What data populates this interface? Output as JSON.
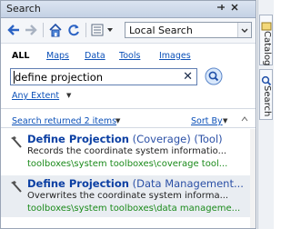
{
  "window": {
    "title": "Search"
  },
  "toolbar": {
    "scope_value": "Local Search"
  },
  "filter_tabs": [
    "ALL",
    "Maps",
    "Data",
    "Tools",
    "Images"
  ],
  "search": {
    "query": "define projection"
  },
  "extent": {
    "label": "Any Extent"
  },
  "results_bar": {
    "summary": "Search returned 2 items",
    "sort_label": "Sort By"
  },
  "results": [
    {
      "name": "Define Projection",
      "type": "(Coverage) (Tool)",
      "description": "Records the coordinate system informatio...",
      "path": "toolboxes\\system toolboxes\\coverage tool..."
    },
    {
      "name": "Define Projection",
      "type": "(Data Management...",
      "description": "Overwrites the coordinate system informa...",
      "path": "toolboxes\\system toolboxes\\data manageme..."
    }
  ],
  "side_tabs": [
    "Catalog",
    "Search"
  ],
  "colors": {
    "link": "#0b50b8",
    "title_link": "#0b3fa3",
    "path_green": "#1a8a1a",
    "titlebar": "#c4d1e4"
  }
}
